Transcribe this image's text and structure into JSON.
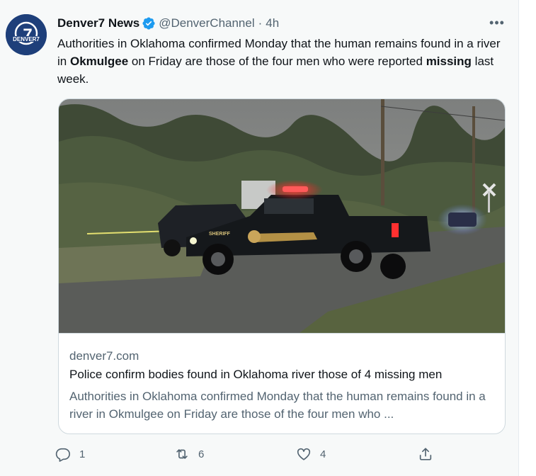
{
  "tweet": {
    "author_name": "Denver7 News",
    "handle": "@DenverChannel",
    "separator": "·",
    "timestamp": "4h",
    "more_label": "•••",
    "text": [
      {
        "t": "Authorities in Oklahoma confirmed Monday that the human remains found in a river in ",
        "bold": false
      },
      {
        "t": "Okmulgee",
        "bold": true
      },
      {
        "t": " on Friday are those of the four men who were reported ",
        "bold": false
      },
      {
        "t": "missing",
        "bold": true
      },
      {
        "t": " last week.",
        "bold": false
      }
    ],
    "avatar_logo_text": "DENVER7",
    "avatar_logo_numeral": "7"
  },
  "card": {
    "domain": "denver7.com",
    "title": "Police confirm bodies found in Oklahoma river those of 4 missing men",
    "description": "Authorities in Oklahoma confirmed Monday that the human remains found in a river in Okmulgee on Friday are those of the four men who ...",
    "image_door_text": "SHERIFF"
  },
  "actions": {
    "reply_count": "1",
    "retweet_count": "6",
    "like_count": "4"
  },
  "colors": {
    "background": "#f7f9f9",
    "text": "#0f1419",
    "secondary": "#536471",
    "verified": "#1d9bf0",
    "border": "#cfd9de"
  },
  "icons": [
    "verified-badge-icon",
    "more-icon",
    "reply-icon",
    "retweet-icon",
    "like-icon",
    "share-icon"
  ]
}
